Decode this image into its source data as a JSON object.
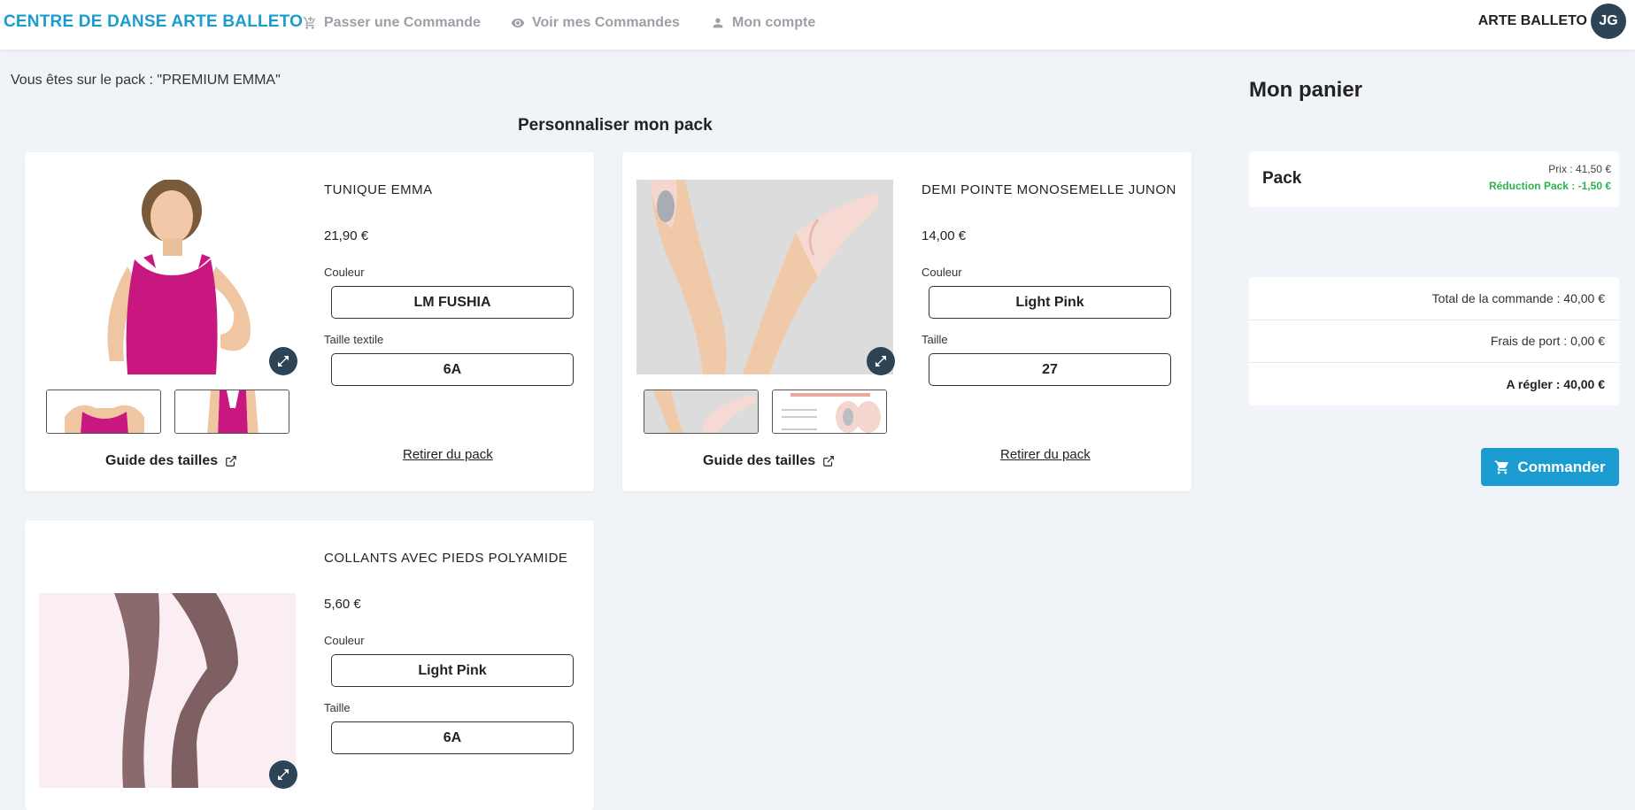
{
  "header": {
    "brand": "CENTRE DE DANSE ARTE BALLETO",
    "nav": [
      {
        "label": "Passer une Commande",
        "icon": "cart-add-icon"
      },
      {
        "label": "Voir mes Commandes",
        "icon": "eye-icon"
      },
      {
        "label": "Mon compte",
        "icon": "person-icon"
      }
    ],
    "user_name": "ARTE BALLETO",
    "avatar_initials": "JG"
  },
  "main": {
    "pack_line": "Vous êtes sur le pack : \"PREMIUM EMMA\"",
    "section_title": "Personnaliser mon pack",
    "products": [
      {
        "name": "TUNIQUE EMMA",
        "price": "21,90 €",
        "fields": [
          {
            "label": "Couleur",
            "value": "LM FUSHIA"
          },
          {
            "label": "Taille textile",
            "value": "6A"
          }
        ],
        "size_guide": "Guide des tailles",
        "remove": "Retirer du pack"
      },
      {
        "name": "DEMI POINTE MONOSEMELLE JUNON",
        "price": "14,00 €",
        "fields": [
          {
            "label": "Couleur",
            "value": "Light Pink"
          },
          {
            "label": "Taille",
            "value": "27"
          }
        ],
        "size_guide": "Guide des tailles",
        "remove": "Retirer du pack"
      },
      {
        "name": "COLLANTS AVEC PIEDS POLYAMIDE",
        "price": "5,60 €",
        "fields": [
          {
            "label": "Couleur",
            "value": "Light Pink"
          },
          {
            "label": "Taille",
            "value": "6A"
          }
        ]
      }
    ]
  },
  "cart": {
    "title": "Mon panier",
    "pack_label": "Pack",
    "pack_price": "Prix : 41,50 €",
    "pack_discount": "Réduction Pack : -1,50 €",
    "total": "Total de la commande : 40,00 €",
    "shipping": "Frais de port : 0,00 €",
    "to_pay": "A régler : 40,00 €",
    "order_button": "Commander"
  },
  "colors": {
    "brand": "#1a9cd0",
    "avatar": "#2d4456",
    "discount": "#2fb24c",
    "background": "#f0f3f7"
  }
}
